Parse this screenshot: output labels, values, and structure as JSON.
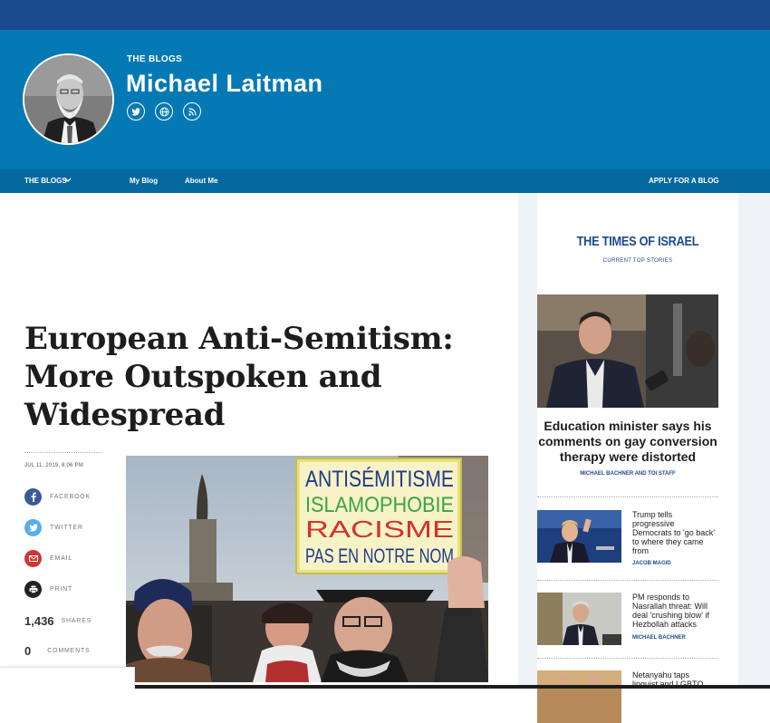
{
  "header": {
    "eyebrow": "THE BLOGS",
    "author": "Michael Laitman",
    "social_icons": [
      "twitter-icon",
      "globe-icon",
      "rss-icon"
    ]
  },
  "nav": {
    "blogs": "THE BLOGS",
    "my_blog": "My Blog",
    "about": "About Me",
    "apply": "APPLY FOR A BLOG"
  },
  "article": {
    "title": "European Anti-Semitism: More Outspoken and Widespread",
    "date": "JUL 11, 2019, 8:06 PM",
    "share": {
      "facebook": "FACEBOOK",
      "twitter": "TWITTER",
      "email": "EMAIL",
      "print": "PRINT"
    },
    "shares_count": "1,436",
    "shares_label": "SHARES",
    "comments_count": "0",
    "comments_label": "COMMENTS",
    "photo_sign": [
      "ANTISÉMITISME",
      "ISLAMOPHOBIE",
      "RACISME",
      "PAS EN NOTRE NOM"
    ]
  },
  "sidebar": {
    "brand": "THE TIMES OF ISRAEL",
    "subtitle": "CURRENT TOP STORIES",
    "lead": {
      "headline": "Education minister says his comments on gay conversion therapy were distorted",
      "byline": "MICHAEL BACHNER AND TOI STAFF"
    },
    "stories": [
      {
        "headline": "Trump tells progressive Democrats to 'go back' to where they came from",
        "byline": "JACOB MAGID"
      },
      {
        "headline": "PM responds to Nasrallah threat: Will deal 'crushing blow' if Hezbollah attacks",
        "byline": "MICHAEL BACHNER"
      },
      {
        "headline": "Netanyahu taps linguist and LGBTQ",
        "byline": ""
      }
    ]
  },
  "colors": {
    "top_strip": "#1c4a8f",
    "header": "#0579b4",
    "nav": "#0569a0",
    "brand": "#1c4a8f",
    "facebook": "#3b5998",
    "twitter": "#55acee",
    "email": "#d23535",
    "print": "#222222"
  }
}
